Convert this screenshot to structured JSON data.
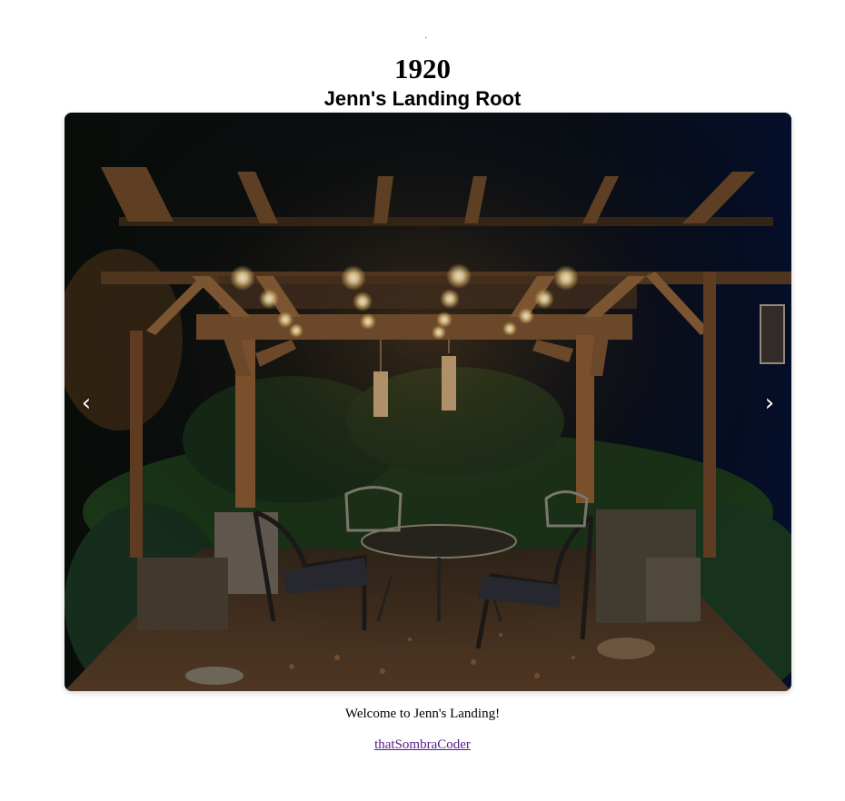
{
  "header": {
    "tick": "'",
    "year": "1920",
    "title": "Jenn's Landing Root"
  },
  "carousel": {
    "prev_label": "‹",
    "next_label": "›",
    "image_alt": "Pergola with string lights and patio furniture at night"
  },
  "footer": {
    "caption": "Welcome to Jenn's Landing!",
    "credit_link": "thatSombraCoder"
  },
  "colors": {
    "link": "#551a8b",
    "wood": "#8a5a33",
    "light": "#ffd98a"
  }
}
